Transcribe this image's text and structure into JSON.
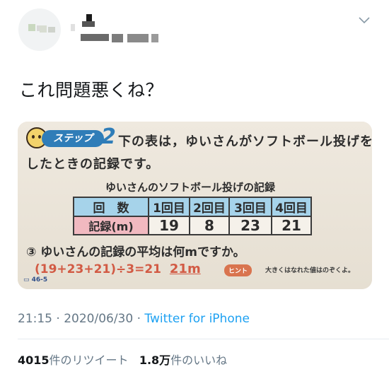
{
  "tweet": {
    "text": "これ問題悪くね？",
    "timestamp": "21:15 · 2020/06/30 · ",
    "source": "Twitter for iPhone",
    "retweet_count": "4015",
    "retweet_label": "件のリツイート",
    "like_count": "1.8万",
    "like_label": "件のいいね"
  },
  "photo": {
    "step_label": "ステップ",
    "step_number": "2",
    "question_line1": "下の表は，ゆいさんがソフトボール投げを",
    "question_line2": "したときの記録です。",
    "table_title": "ゆいさんのソフトボール投げの記録",
    "table": {
      "header_label": "回　数",
      "headers": [
        "1回目",
        "2回目",
        "3回目",
        "4回目"
      ],
      "row_label": "記録(m)",
      "values": [
        "19",
        "8",
        "23",
        "21"
      ]
    },
    "question3": "③ ゆいさんの記録の平均は何mですか。",
    "answer_work": "(19+23+21)÷3=21",
    "answer_final": "21m",
    "hint_label": "ヒント",
    "hint_text": "大きくはなれた値はのぞくよ。",
    "ref": "46-5"
  },
  "icons": {
    "caret": "chevron-down-icon"
  }
}
